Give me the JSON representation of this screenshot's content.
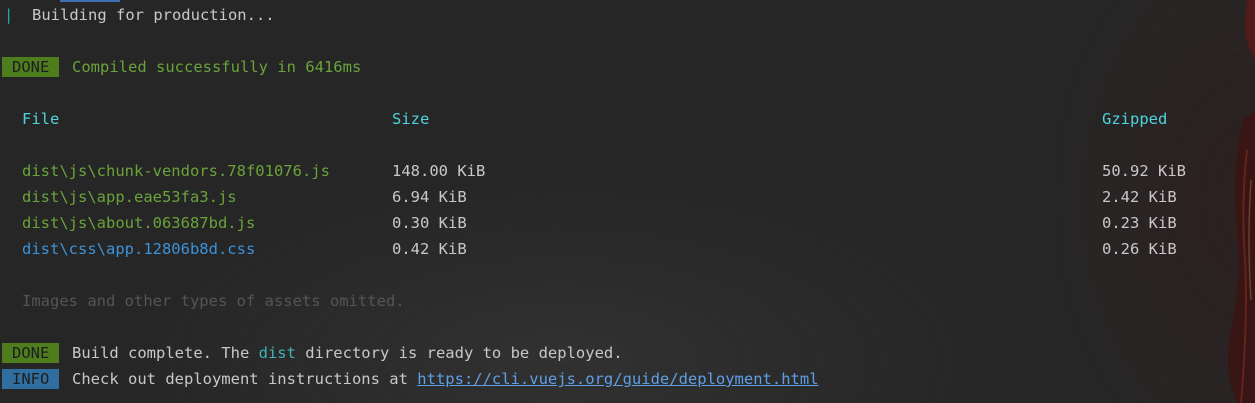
{
  "header": {
    "cursor_glyph": "|",
    "building_text": "Building for production..."
  },
  "compile_status": {
    "badge": "DONE",
    "message": "Compiled successfully in 6416ms"
  },
  "table": {
    "headers": {
      "file": "File",
      "size": "Size",
      "gzipped": "Gzipped"
    },
    "rows": [
      {
        "file": "dist\\js\\chunk-vendors.78f01076.js",
        "size": "148.00 KiB",
        "gzipped": "50.92 KiB",
        "kind": "js"
      },
      {
        "file": "dist\\js\\app.eae53fa3.js",
        "size": "6.94 KiB",
        "gzipped": "2.42 KiB",
        "kind": "js"
      },
      {
        "file": "dist\\js\\about.063687bd.js",
        "size": "0.30 KiB",
        "gzipped": "0.23 KiB",
        "kind": "js"
      },
      {
        "file": "dist\\css\\app.12806b8d.css",
        "size": "0.42 KiB",
        "gzipped": "0.26 KiB",
        "kind": "css"
      }
    ]
  },
  "omitted_note": "Images and other types of assets omitted.",
  "build_complete": {
    "badge": "DONE",
    "text_before": "Build complete. The ",
    "dir_name": "dist",
    "text_after": " directory is ready to be deployed."
  },
  "info": {
    "badge": "INFO",
    "text": "Check out deployment instructions at ",
    "link": "https://cli.vuejs.org/guide/deployment.html"
  },
  "colors": {
    "background": "#262626",
    "done_badge": "#4e7d1e",
    "info_badge": "#2f6e9e",
    "success_green": "#6aa33a",
    "header_cyan": "#4fd3de",
    "css_file_blue": "#3c92d8",
    "link_blue": "#5f9fe6"
  }
}
